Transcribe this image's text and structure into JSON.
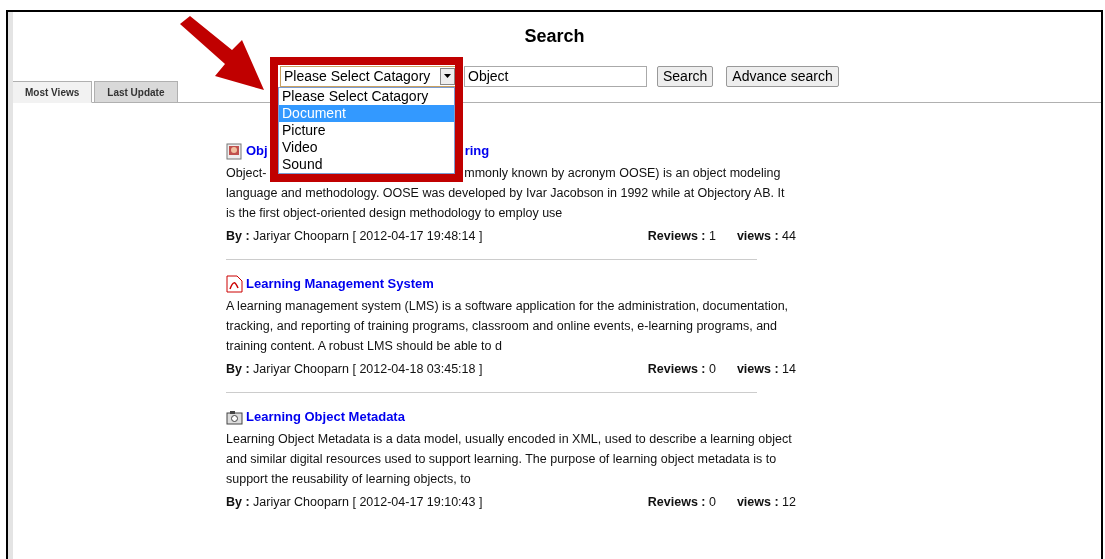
{
  "page_title": "Search",
  "search": {
    "category": {
      "value": "Please Select Catagory",
      "expanded": true,
      "options": [
        {
          "label": "Please Select Catagory",
          "highlighted": false
        },
        {
          "label": "Document",
          "highlighted": true
        },
        {
          "label": "Picture",
          "highlighted": false
        },
        {
          "label": "Video",
          "highlighted": false
        },
        {
          "label": "Sound",
          "highlighted": false
        }
      ]
    },
    "query": "Object",
    "buttons": [
      "Search",
      "Advance search"
    ]
  },
  "tabs": [
    {
      "label": "Most Views",
      "selected": true
    },
    {
      "label": "Last Update",
      "selected": false
    }
  ],
  "results": [
    {
      "kind": "image",
      "title_parts": [
        "Obj",
        "ring"
      ],
      "description_lines": [
        [
          "Object-",
          "mmonly known by acronym OOSE) is an object modeling"
        ],
        [
          "language and methodology. OOSE was developed by Ivar Jacobson in 1992 while at Objectory AB. It"
        ],
        [
          "is the first object-oriented design methodology to employ use"
        ]
      ],
      "byline": "**By :** Jariyar Chooparn [ 2012-04-17 19:48:14 ]",
      "reviews": "**Reviews :** 1",
      "views": "**views :** 44"
    },
    {
      "kind": "pdf",
      "title_parts": [
        "Learning Management System"
      ],
      "description_lines": [
        [
          "A learning management system (LMS) is a software application for the administration, documentation,"
        ],
        [
          "tracking, and reporting of training programs, classroom and online events, e-learning programs, and"
        ],
        [
          "training content. A robust LMS should be able to d"
        ]
      ],
      "byline": "**By :** Jariyar Chooparn [ 2012-04-18 03:45:18 ]",
      "reviews": "**Reviews :** 0",
      "views": "**views :** 14"
    },
    {
      "kind": "camera",
      "title_parts": [
        "Learning Object Metadata"
      ],
      "description_lines": [
        [
          "Learning Object Metadata is a data model, usually encoded in XML, used to describe a learning object"
        ],
        [
          "and similar digital resources used to support learning. The purpose of learning object metadata is to"
        ],
        [
          "support the reusability of learning objects, to"
        ]
      ],
      "byline": "**By :** Jariyar Chooparn [ 2012-04-17 19:10:43 ]",
      "reviews": "**Reviews :** 0",
      "views": "**views :** 12"
    }
  ]
}
